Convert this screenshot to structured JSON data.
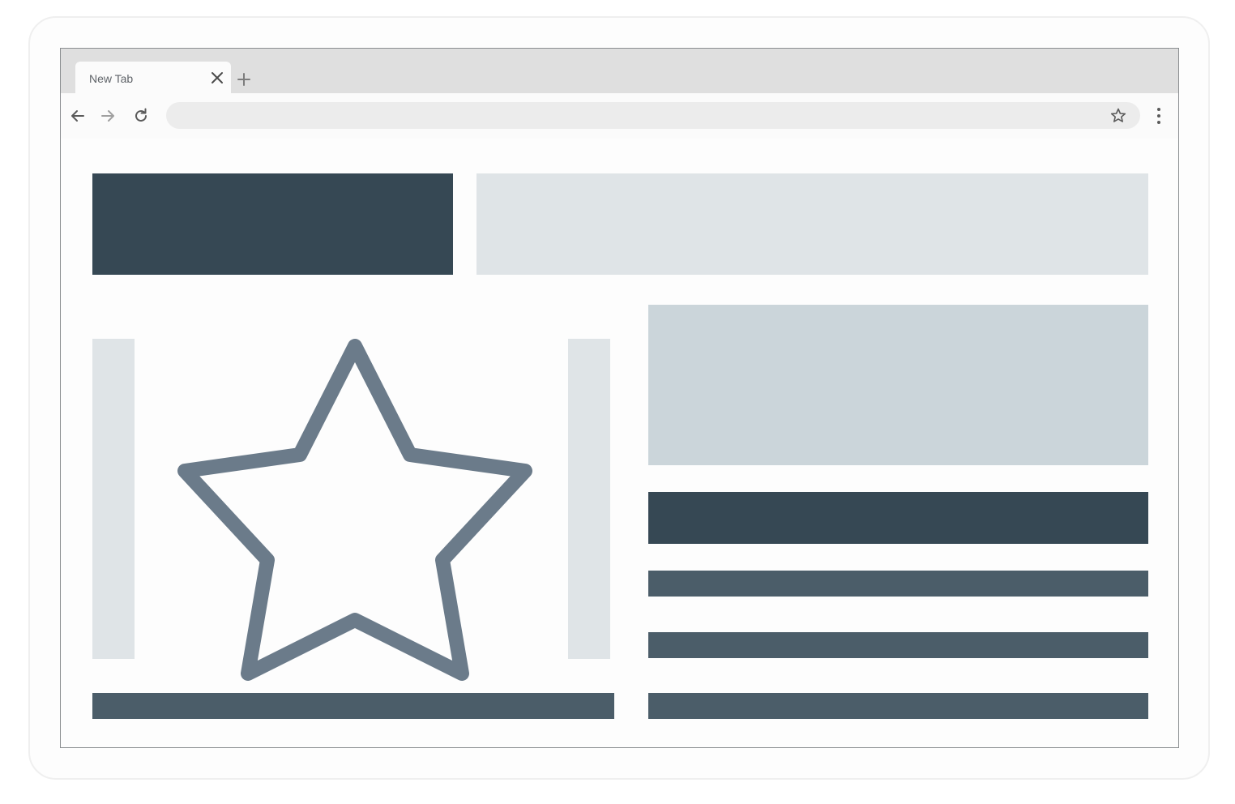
{
  "browser": {
    "tab": {
      "title": "New Tab",
      "close_icon": "close-icon"
    },
    "new_tab_icon": "plus-icon",
    "toolbar": {
      "back_icon": "arrow-left-icon",
      "forward_icon": "arrow-right-icon",
      "reload_icon": "reload-icon",
      "address_value": "",
      "bookmark_icon": "star-outline-icon",
      "menu_icon": "more-vertical-icon"
    }
  },
  "page": {
    "illustration_icon": "star-outline-icon",
    "colors": {
      "dark_block": "#364854",
      "mid_block": "#4b5d69",
      "light_block": "#dfe4e7",
      "medium_light_block": "#cbd5da",
      "star_stroke": "#6b7b8a"
    }
  }
}
